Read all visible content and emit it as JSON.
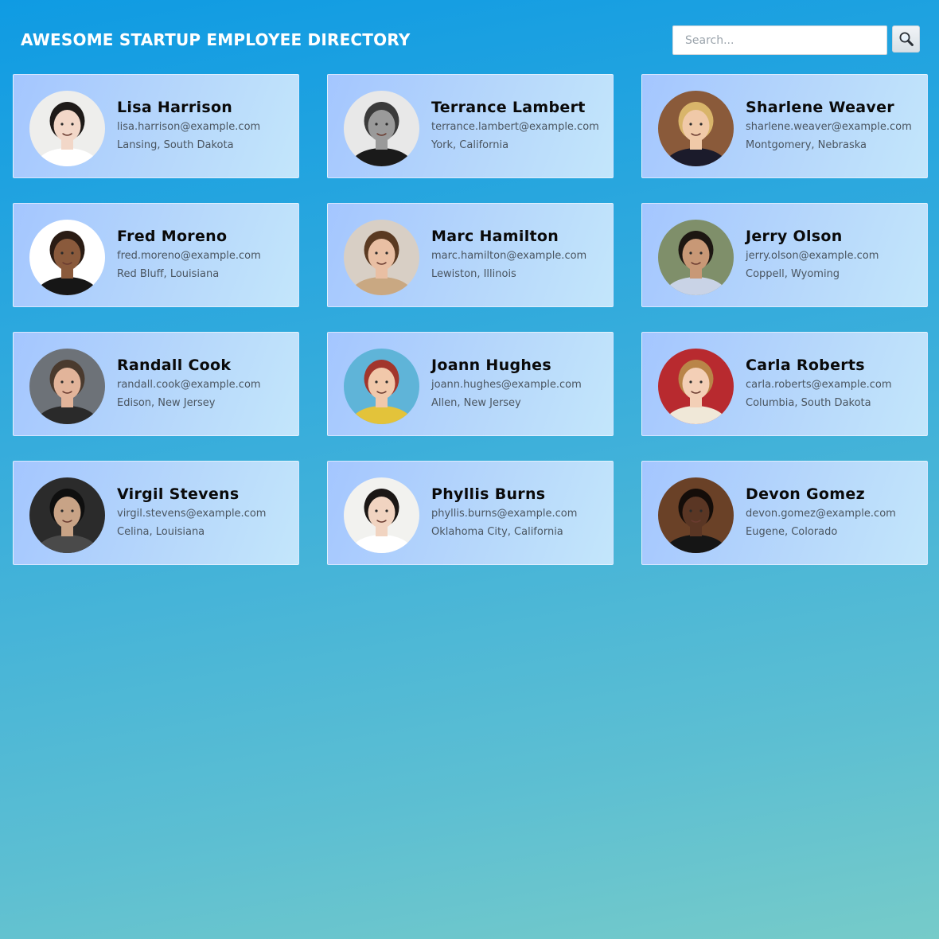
{
  "header": {
    "title": "AWESOME STARTUP EMPLOYEE DIRECTORY",
    "search": {
      "placeholder": "Search...",
      "value": "",
      "button_icon": "magnifying-glass-icon"
    }
  },
  "employees": [
    {
      "name": "Lisa Harrison",
      "email": "lisa.harrison@example.com",
      "location": "Lansing, South Dakota",
      "avatar": {
        "bg": "#eeeeec",
        "hair": "#1e1a18",
        "skin": "#f2d7c8",
        "shirt": "#ffffff"
      }
    },
    {
      "name": "Terrance Lambert",
      "email": "terrance.lambert@example.com",
      "location": "York, California",
      "avatar": {
        "bg": "#e8e8e8",
        "hair": "#3a3a3a",
        "skin": "#9a9a9a",
        "shirt": "#1a1a1a"
      }
    },
    {
      "name": "Sharlene Weaver",
      "email": "sharlene.weaver@example.com",
      "location": "Montgomery, Nebraska",
      "avatar": {
        "bg": "#8a5a3a",
        "hair": "#d9b56a",
        "skin": "#f0c9a8",
        "shirt": "#1b1b2b"
      }
    },
    {
      "name": "Fred Moreno",
      "email": "fred.moreno@example.com",
      "location": "Red Bluff, Louisiana",
      "avatar": {
        "bg": "#ffffff",
        "hair": "#2a1c14",
        "skin": "#8a5a3c",
        "shirt": "#161616"
      }
    },
    {
      "name": "Marc Hamilton",
      "email": "marc.hamilton@example.com",
      "location": "Lewiston, Illinois",
      "avatar": {
        "bg": "#d8cfc5",
        "hair": "#5a3a22",
        "skin": "#e9bfa3",
        "shirt": "#c9a882"
      }
    },
    {
      "name": "Jerry Olson",
      "email": "jerry.olson@example.com",
      "location": "Coppell, Wyoming",
      "avatar": {
        "bg": "#7f8f6a",
        "hair": "#1d1712",
        "skin": "#c89876",
        "shirt": "#c9d3e6"
      }
    },
    {
      "name": "Randall Cook",
      "email": "randall.cook@example.com",
      "location": "Edison, New Jersey",
      "avatar": {
        "bg": "#6d7278",
        "hair": "#4a3a2e",
        "skin": "#e2b49a",
        "shirt": "#2a2a2a"
      }
    },
    {
      "name": "Joann Hughes",
      "email": "joann.hughes@example.com",
      "location": "Allen, New Jersey",
      "avatar": {
        "bg": "#5fb4d8",
        "hair": "#a2362c",
        "skin": "#f1c8aa",
        "shirt": "#e3c33a"
      }
    },
    {
      "name": "Carla Roberts",
      "email": "carla.roberts@example.com",
      "location": "Columbia, South Dakota",
      "avatar": {
        "bg": "#b82a2f",
        "hair": "#b98548",
        "skin": "#f3cfb6",
        "shirt": "#f0e8d8"
      }
    },
    {
      "name": "Virgil Stevens",
      "email": "virgil.stevens@example.com",
      "location": "Celina, Louisiana",
      "avatar": {
        "bg": "#2b2b2b",
        "hair": "#0f0f0f",
        "skin": "#c8a386",
        "shirt": "#4a4a4a"
      }
    },
    {
      "name": "Phyllis Burns",
      "email": "phyllis.burns@example.com",
      "location": "Oklahoma City, California",
      "avatar": {
        "bg": "#f2f2ef",
        "hair": "#1b1715",
        "skin": "#f1d4c1",
        "shirt": "#ffffff"
      }
    },
    {
      "name": "Devon Gomez",
      "email": "devon.gomez@example.com",
      "location": "Eugene, Colorado",
      "avatar": {
        "bg": "#6a4127",
        "hair": "#140d09",
        "skin": "#5a3624",
        "shirt": "#151515"
      }
    }
  ]
}
